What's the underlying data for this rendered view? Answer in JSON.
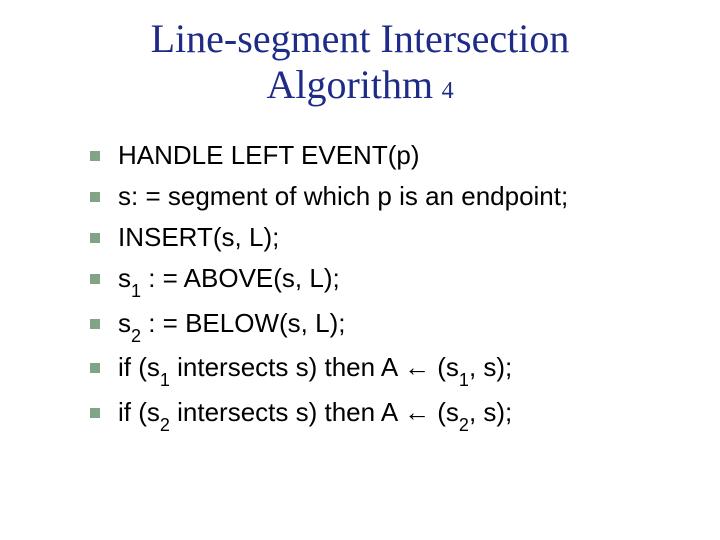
{
  "slide": {
    "title_line1": "Line-segment Intersection",
    "title_line2_main": "Algorithm",
    "title_line2_sub": "4",
    "bullets": [
      {
        "plain": "HANDLE LEFT EVENT(p)"
      },
      {
        "plain": "s: = segment of which p is an endpoint;"
      },
      {
        "plain": "INSERT(s, L);"
      },
      {
        "html_parts": {
          "p0": "s",
          "sub0": "1",
          "p1": " : = ABOVE(s, L);"
        }
      },
      {
        "html_parts": {
          "p0": "s",
          "sub0": "2",
          "p1": " : = BELOW(s, L);"
        }
      },
      {
        "html_parts": {
          "p0": "if (s",
          "sub0": "1",
          "p1": " intersects s) then A ",
          "arrow": "←",
          "p2": " (s",
          "sub1": "1",
          "p3": ", s);"
        }
      },
      {
        "html_parts": {
          "p0": "if (s",
          "sub0": "2",
          "p1": " intersects s) then A ",
          "arrow": "←",
          "p2": " (s",
          "sub1": "2",
          "p3": ", s);"
        }
      }
    ]
  }
}
